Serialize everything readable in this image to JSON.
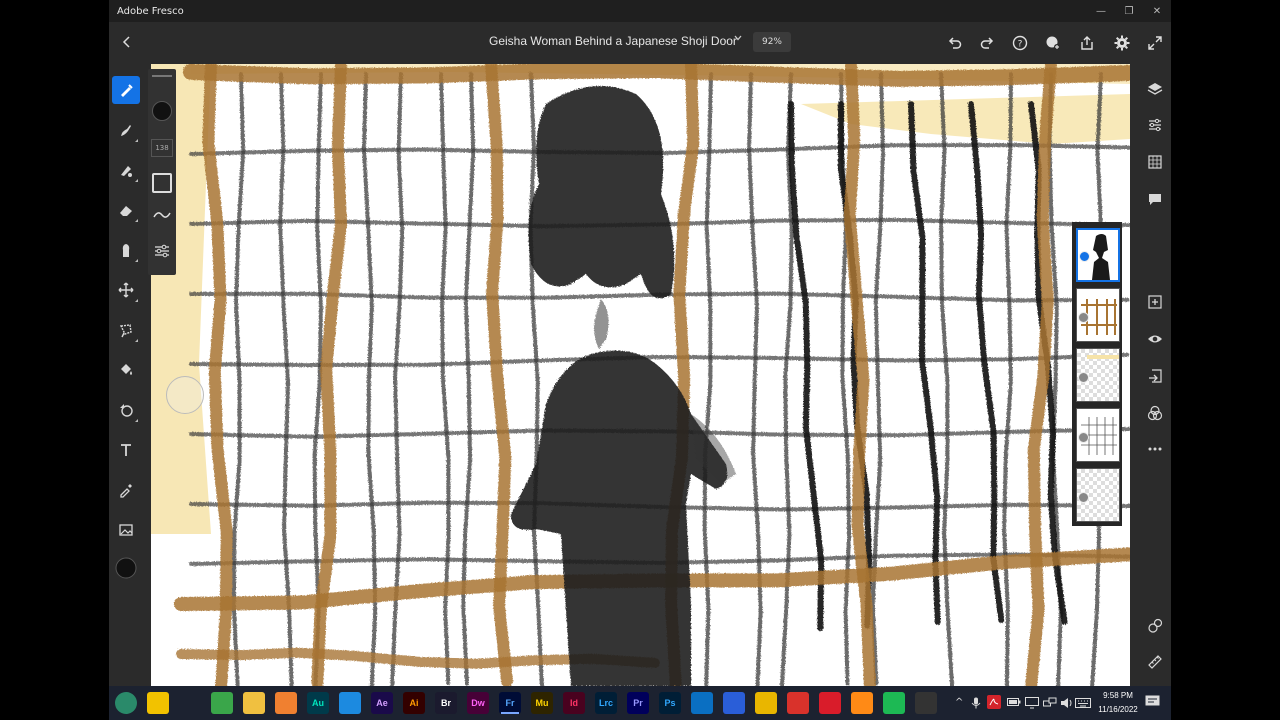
{
  "window": {
    "app_title": "Adobe Fresco",
    "controls": [
      "—",
      "❐",
      "✕"
    ]
  },
  "header": {
    "doc_title": "Geisha Woman Behind a Japanese Shoji Door",
    "zoom": "92%",
    "icons": [
      "undo-icon",
      "redo-icon",
      "help-icon",
      "invite-icon",
      "share-icon",
      "settings-icon",
      "fullscreen-icon"
    ]
  },
  "tools": [
    "pixel-brush-icon",
    "live-brush-icon",
    "vector-brush-icon",
    "eraser-icon",
    "smudge-icon",
    "move-icon",
    "lasso-icon",
    "fill-icon",
    "shape-icon",
    "type-icon",
    "eyedropper-icon",
    "image-icon",
    "color-swatch"
  ],
  "brush": {
    "size": "138"
  },
  "right_tools": [
    "layers-icon",
    "layer-properties-icon",
    "grid-icon",
    "comment-icon",
    "add-layer-icon",
    "visibility-icon",
    "import-icon",
    "blend-icon",
    "more-icon",
    "blend-modes-icon",
    "ruler-icon"
  ],
  "layers": [
    {
      "name": "geisha",
      "selected": true
    },
    {
      "name": "brown-frame",
      "selected": false
    },
    {
      "name": "yellow-wash",
      "selected": false
    },
    {
      "name": "grid-lines",
      "selected": false
    },
    {
      "name": "blank",
      "selected": false
    }
  ],
  "colors": {
    "accent": "#1473e6",
    "brown": "#a87432",
    "ink": "#1a1a1a",
    "wash": "#f6e3a8"
  },
  "taskbar": {
    "apps": [
      {
        "label": "",
        "name": "chrome-like-start-icon",
        "bg": "#2a8a6a"
      },
      {
        "label": "",
        "name": "norton-icon",
        "bg": "#f2c200"
      },
      {
        "label": "",
        "name": "3d-viewer-icon",
        "bg": "#1c2230"
      },
      {
        "label": "",
        "name": "notepad-icon",
        "bg": "#3aa64a"
      },
      {
        "label": "",
        "name": "file-explorer-icon",
        "bg": "#f0c040"
      },
      {
        "label": "",
        "name": "media-player-icon",
        "bg": "#f08030"
      },
      {
        "label": "Au",
        "name": "audition-icon",
        "bg": "#003a4a",
        "fg": "#00e4bb"
      },
      {
        "label": "",
        "name": "edge-icon",
        "bg": "#1c8ae0"
      },
      {
        "label": "Ae",
        "name": "after-effects-icon",
        "bg": "#1a0a4a",
        "fg": "#d29fff"
      },
      {
        "label": "Ai",
        "name": "illustrator-icon",
        "bg": "#330000",
        "fg": "#ff9a00"
      },
      {
        "label": "Br",
        "name": "bridge-icon",
        "bg": "#1b1a2e",
        "fg": "#ffffff"
      },
      {
        "label": "Dw",
        "name": "dreamweaver-icon",
        "bg": "#470137",
        "fg": "#ff61f6"
      },
      {
        "label": "Fr",
        "name": "fresco-icon",
        "bg": "#000c36",
        "fg": "#56a8ff",
        "active": true
      },
      {
        "label": "Mu",
        "name": "muse-icon",
        "bg": "#2e2400",
        "fg": "#ffd500"
      },
      {
        "label": "Id",
        "name": "indesign-icon",
        "bg": "#49021f",
        "fg": "#ff3366"
      },
      {
        "label": "Lrc",
        "name": "lightroom-classic-icon",
        "bg": "#001e36",
        "fg": "#31a8ff"
      },
      {
        "label": "Pr",
        "name": "premiere-icon",
        "bg": "#00005b",
        "fg": "#9999ff"
      },
      {
        "label": "Ps",
        "name": "photoshop-icon",
        "bg": "#001e36",
        "fg": "#31a8ff"
      },
      {
        "label": "",
        "name": "edge-dev-icon",
        "bg": "#0a6fc2"
      },
      {
        "label": "",
        "name": "firefox-dev-icon",
        "bg": "#2a5ed8"
      },
      {
        "label": "",
        "name": "chrome-icon",
        "bg": "#e9b600"
      },
      {
        "label": "",
        "name": "vivaldi-icon",
        "bg": "#d9322b"
      },
      {
        "label": "",
        "name": "opera-icon",
        "bg": "#d91c2a"
      },
      {
        "label": "",
        "name": "firefox-icon",
        "bg": "#ff8a16"
      },
      {
        "label": "",
        "name": "spotify-icon",
        "bg": "#1db954"
      },
      {
        "label": "",
        "name": "obs-icon",
        "bg": "#333333"
      }
    ],
    "time": "9:58 PM",
    "date": "11/16/2022"
  }
}
